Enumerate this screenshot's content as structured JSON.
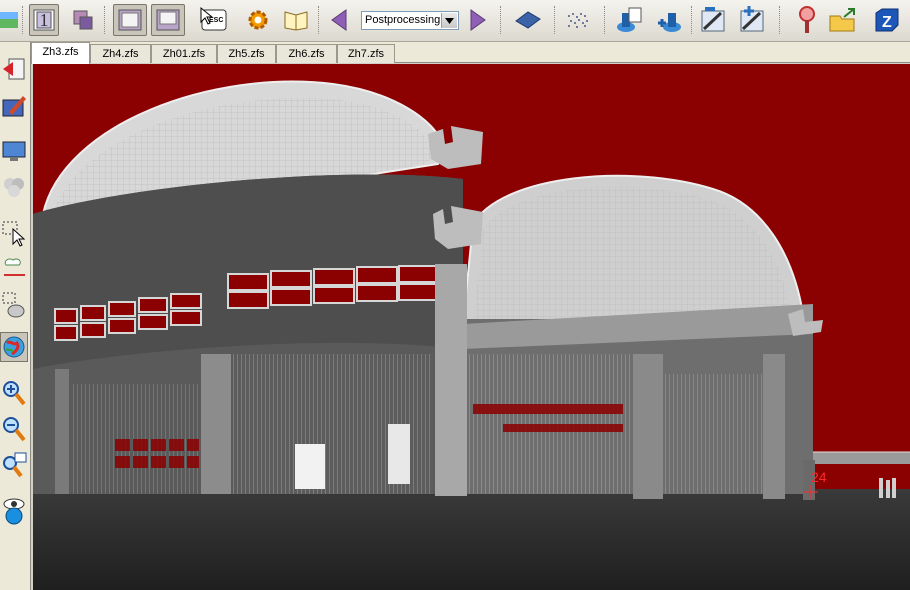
{
  "toolbar": {
    "mode_select": {
      "value": "Postprocessing"
    },
    "esc_label": "ESC",
    "view_one_label": "1"
  },
  "tabs": [
    {
      "label": "Zh3.zfs",
      "active": true
    },
    {
      "label": "Zh4.zfs",
      "active": false
    },
    {
      "label": "Zh01.zfs",
      "active": false
    },
    {
      "label": "Zh5.zfs",
      "active": false
    },
    {
      "label": "Zh6.zfs",
      "active": false
    },
    {
      "label": "Zh7.zfs",
      "active": false
    }
  ],
  "viewport": {
    "marker_label": "24",
    "background_color": "#8b0000"
  },
  "colors": {
    "accent_purple": "#7b3fa0",
    "toolbar_bg": "#dcd9cf",
    "tab_active_bg": "#ffffff"
  }
}
